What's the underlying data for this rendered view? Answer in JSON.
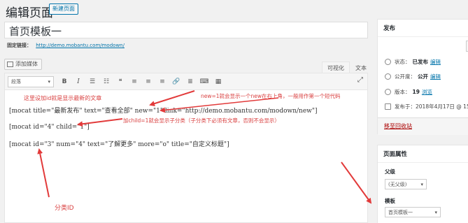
{
  "header": {
    "title": "编辑页面",
    "add_new": "新建页面"
  },
  "post": {
    "title_value": "首页模板一"
  },
  "permalink": {
    "label": "固定链接：",
    "url": "http://demo.mobantu.com/modown/"
  },
  "media": {
    "add_media": "添加媒体"
  },
  "editor_tabs": {
    "visual": "可视化",
    "text": "文本"
  },
  "toolbar": {
    "format_value": "段落",
    "buttons": [
      "B",
      "I",
      "☰",
      "☷",
      "❝",
      "≡",
      "≡",
      "≡",
      "🔗",
      "≣",
      "⌨",
      "▦"
    ],
    "expand_icon": "⤢"
  },
  "content": {
    "line1": "[mocat title=\"最新发布\" text=\"查看全部\" new=\"1\" link=\"http://demo.mobantu.com/modown/new\"]",
    "line2": "[mocat id=\"4\" child=\"1\"]",
    "line3": "[mocat id=\"3\" num=\"4\" text=\"了解更多\" more=\"o\" title=\"自定义标题\"]"
  },
  "annotations": {
    "a1": "这里设加id就是显示最新的文章",
    "a2": "new=1就会显示一个new在右上角，一般用作第一个短代码",
    "a3": "加child=1就会显示子分类（子分类下必须有文章，否则不会显示）",
    "a4": "分类ID"
  },
  "publish": {
    "title": "发布",
    "status_label": "状态：",
    "status_value": "已发布",
    "status_edit": "编辑",
    "visibility_label": "公开度：",
    "visibility_value": "公开",
    "visibility_edit": "编辑",
    "revisions_label": "版本：",
    "revisions_value": "19",
    "revisions_link": "浏览",
    "published_label": "发布于：",
    "published_value": "2018年4月17日 @ 15",
    "trash": "移至回收站"
  },
  "page_attributes": {
    "title": "页面属性",
    "parent_label": "父级",
    "parent_value": "(无父级)",
    "template_label": "模板",
    "template_value": "首页模板一"
  },
  "colors": {
    "annotation": "#d94040",
    "link": "#0073aa"
  }
}
